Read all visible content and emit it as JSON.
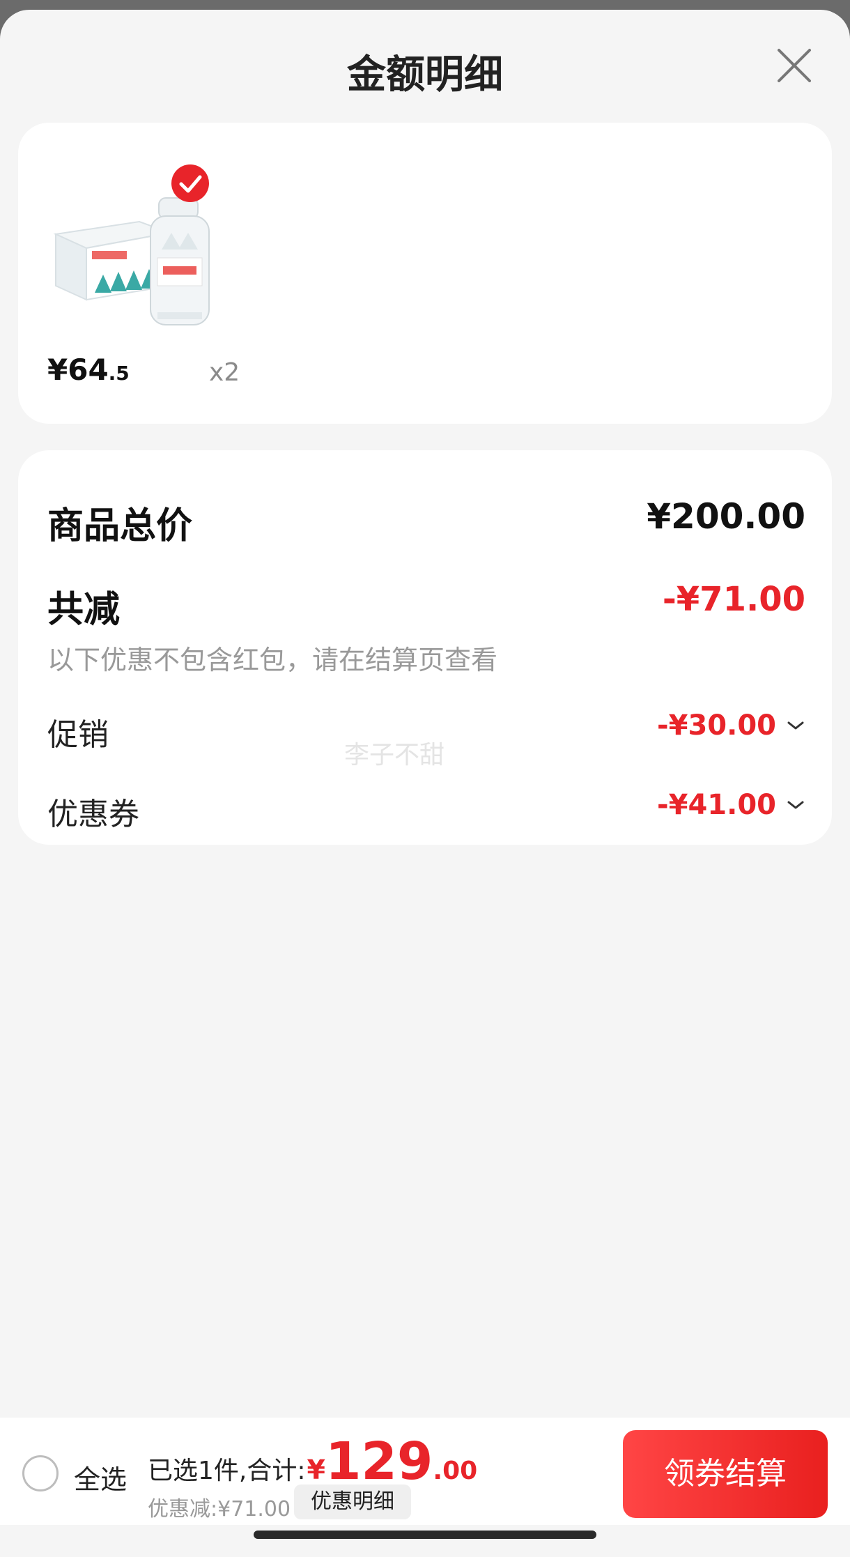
{
  "header": {
    "title": "金额明细"
  },
  "product": {
    "price_int": "¥64",
    "price_dec": ".5",
    "qty": "x2"
  },
  "summary": {
    "total_label": "商品总价",
    "total_value": "¥200.00",
    "reduce_label": "共减",
    "reduce_value": "-¥71.00",
    "note": "以下优惠不包含红包，请在结算页查看",
    "promo_label": "促销",
    "promo_value": "-¥30.00",
    "coupon_label": "优惠券",
    "coupon_value": "-¥41.00"
  },
  "watermark": "李子不甜",
  "bottom": {
    "select_all": "全选",
    "selected_text": "已选1件,合计:",
    "total_yen": "¥",
    "total_int": "129",
    "total_dec": ".00",
    "discount_text": "优惠减:¥71.00",
    "detail_button": "优惠明细",
    "checkout_button": "领券结算"
  },
  "colors": {
    "accent_red": "#e8242a",
    "background": "#f5f5f5"
  },
  "icons": {
    "close": "close-icon",
    "check_badge": "check-badge-icon",
    "chevron": "chevron-down-icon"
  }
}
